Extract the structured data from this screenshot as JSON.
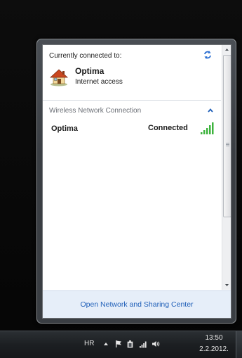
{
  "popup": {
    "header_label": "Currently connected to:",
    "network": {
      "name": "Optima",
      "status": "Internet access",
      "icon": "home-network-icon"
    },
    "section": {
      "title": "Wireless Network Connection",
      "collapse_icon": "chevron-up-icon"
    },
    "wifi_item": {
      "name": "Optima",
      "status": "Connected",
      "icon": "signal-strength-icon"
    },
    "footer_link": "Open Network and Sharing Center",
    "refresh_icon": "refresh-icon"
  },
  "taskbar": {
    "language": "HR",
    "time": "13:50",
    "date": "2.2.2012.",
    "icons": [
      "chevron-up-icon",
      "flag-icon",
      "battery-plug-icon",
      "network-signal-icon",
      "volume-icon"
    ]
  },
  "colors": {
    "link": "#1f5fb8",
    "signal_green": "#3db33d",
    "footer_bg": "#e6eef9"
  }
}
